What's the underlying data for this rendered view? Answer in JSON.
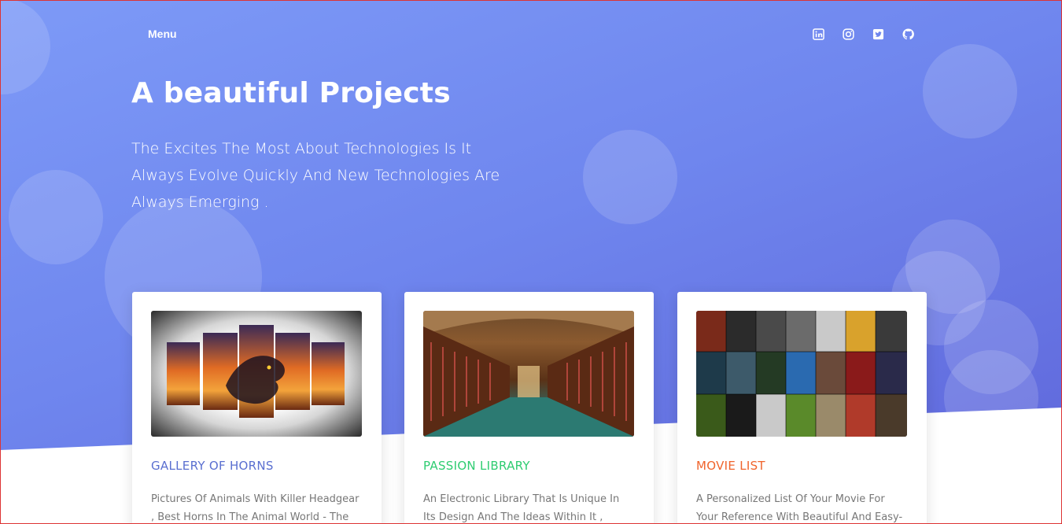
{
  "nav": {
    "menu_label": "Menu",
    "social_icons": [
      "linkedin-icon",
      "instagram-icon",
      "twitter-icon",
      "github-icon"
    ]
  },
  "hero": {
    "title": "A beautiful Projects",
    "subtitle": "The Excites The Most About Technologies Is It Always Evolve Quickly And New Technologies Are Always Emerging ."
  },
  "colors": {
    "gradient_start": "#7d9af7",
    "gradient_end": "#5e64d9",
    "card1_title": "#5a6fd0",
    "card2_title": "#2ecc71",
    "card3_title": "#f0642c"
  },
  "cards": [
    {
      "title": "GALLERY OF HORNS",
      "description": "Pictures Of Animals With Killer Headgear , Best Horns In The Animal World - The"
    },
    {
      "title": "PASSION LIBRARY",
      "description": "An Electronic Library That Is Unique In Its Design And The Ideas Within It , Beautiful"
    },
    {
      "title": "MOVIE LIST",
      "description": "A Personalized List Of Your Movie For Your Reference With Beautiful And Easy-To-Use"
    }
  ]
}
